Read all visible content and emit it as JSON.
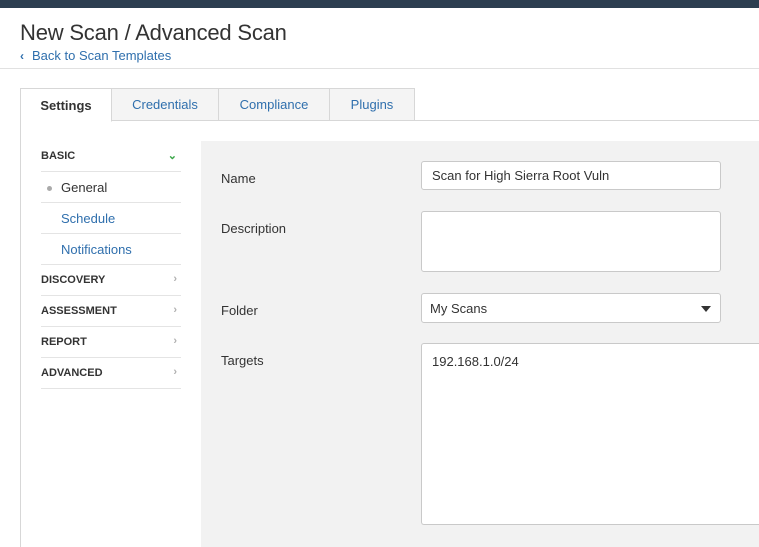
{
  "header": {
    "title": "New Scan / Advanced Scan",
    "back_link": "Back to Scan Templates"
  },
  "tabs": [
    {
      "label": "Settings",
      "active": true
    },
    {
      "label": "Credentials"
    },
    {
      "label": "Compliance"
    },
    {
      "label": "Plugins"
    }
  ],
  "sidebar": {
    "items": [
      {
        "label": "BASIC",
        "type": "section",
        "icon": "chevron-down-icon"
      },
      {
        "label": "General",
        "type": "sub",
        "current": true
      },
      {
        "label": "Schedule",
        "type": "sub"
      },
      {
        "label": "Notifications",
        "type": "sub"
      },
      {
        "label": "DISCOVERY",
        "type": "section",
        "icon": "chevron-right-icon"
      },
      {
        "label": "ASSESSMENT",
        "type": "section",
        "icon": "chevron-right-icon"
      },
      {
        "label": "REPORT",
        "type": "section",
        "icon": "chevron-right-icon"
      },
      {
        "label": "ADVANCED",
        "type": "section",
        "icon": "chevron-right-icon"
      }
    ]
  },
  "form": {
    "name_label": "Name",
    "name_value": "Scan for High Sierra Root Vuln",
    "description_label": "Description",
    "description_value": "",
    "folder_label": "Folder",
    "folder_value": "My Scans",
    "targets_label": "Targets",
    "targets_value": "192.168.1.0/24"
  },
  "colors": {
    "topbar": "#2c3e50",
    "link": "#2f6fad",
    "open_chevron": "#3aa648",
    "content_bg": "#f2f2f2"
  }
}
